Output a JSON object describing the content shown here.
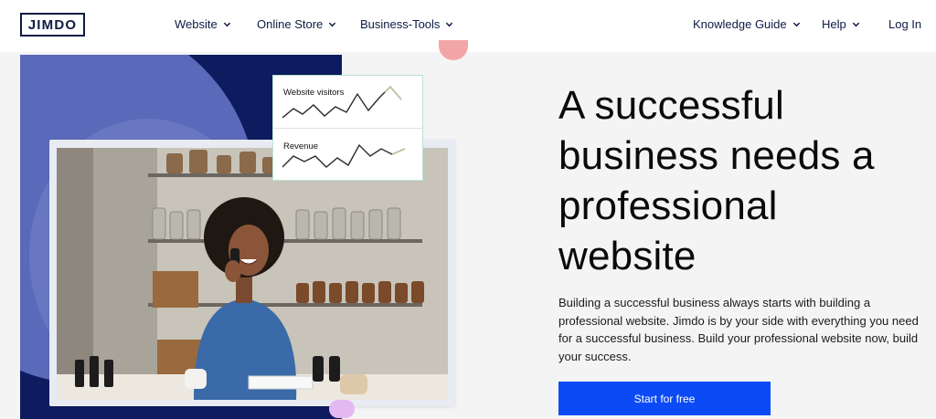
{
  "header": {
    "logo": "JIMDO",
    "nav_left": [
      {
        "label": "Website"
      },
      {
        "label": "Online Store"
      },
      {
        "label": "Business-Tools"
      }
    ],
    "nav_right": [
      {
        "label": "Knowledge Guide"
      },
      {
        "label": "Help"
      }
    ],
    "login_label": "Log In"
  },
  "hero": {
    "title": "A successful business needs a professional website",
    "body": "Building a successful business always starts with building a professional website. Jimdo is by your side with everything you need for a successful business. Build your professional website now, build your success.",
    "cta_label": "Start for free"
  },
  "stats_card": {
    "visitors_label": "Website visitors",
    "revenue_label": "Revenue"
  },
  "colors": {
    "brand_navy": "#0e1b44",
    "cta_blue": "#0b4af5",
    "panel_navy": "#0e1b5e"
  }
}
